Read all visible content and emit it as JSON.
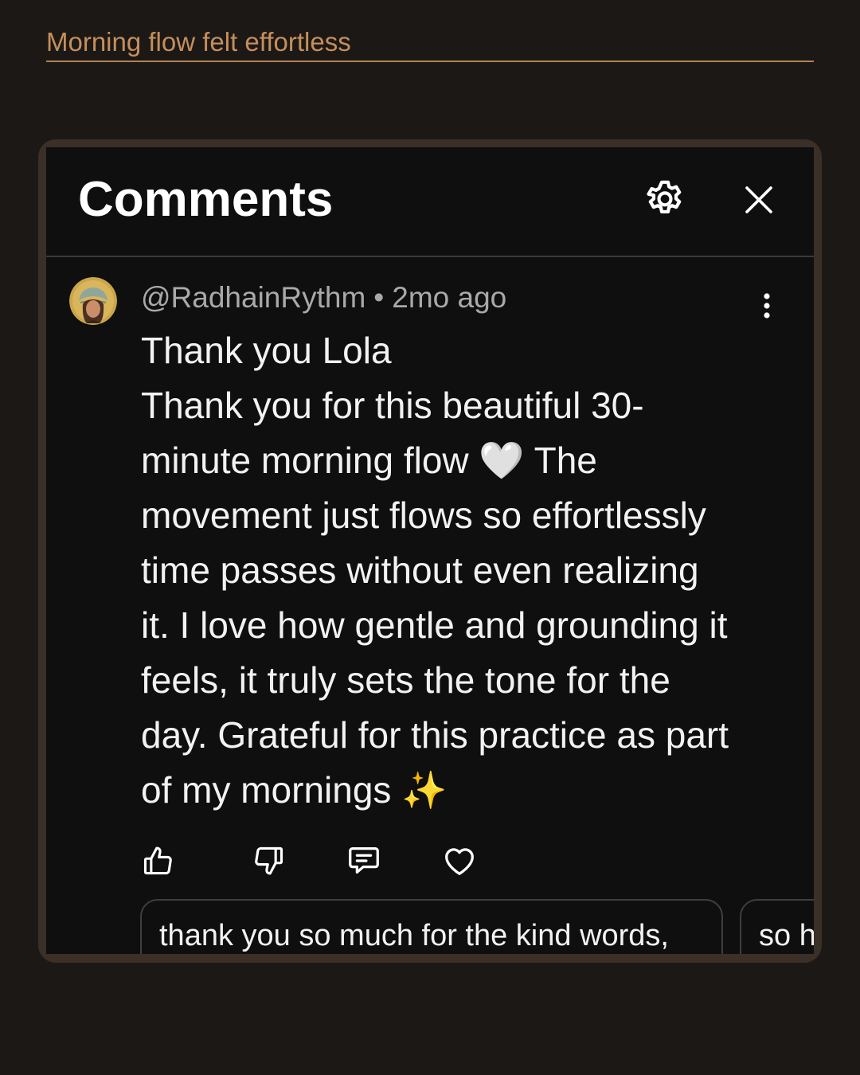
{
  "headline": "Morning flow felt effortless",
  "panel": {
    "title": "Comments",
    "settings_icon": "gear-icon",
    "close_icon": "close-icon"
  },
  "comment": {
    "handle": "@RadhainRythm",
    "separator": "•",
    "time": "2mo ago",
    "lines": [
      "Thank you Lola",
      "Thank you for this beautiful 30-",
      "minute morning flow 🤍 The",
      "movement just flows so effortlessly",
      "time passes without even realizing",
      "it. I love how gentle and grounding it",
      "feels, it truly sets the tone for the",
      "day. Grateful for this practice as part",
      "of my mornings ✨"
    ],
    "actions": [
      "thumbs-up-icon",
      "thumbs-down-icon",
      "reply-icon",
      "heart-icon"
    ]
  },
  "replies": [
    "thank you so much for the kind words,",
    "so h"
  ],
  "colors": {
    "background": "#1c1815",
    "accent": "#c48f5c",
    "panel": "#0f0f0f",
    "frame": "#3a3028"
  }
}
